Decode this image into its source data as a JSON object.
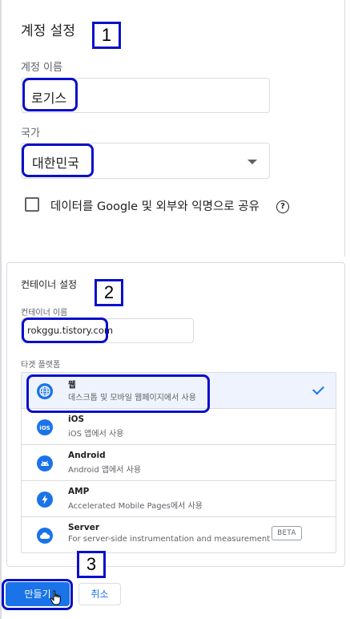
{
  "account": {
    "section_title": "계정 설정",
    "name_label": "계정 이름",
    "name_value": "로기스",
    "country_label": "국가",
    "country_value": "대한민국",
    "share_checkbox_label": "데이터를 Google 및 외부와 익명으로 공유",
    "share_checked": false
  },
  "container": {
    "section_title": "컨테이너 설정",
    "name_label": "컨테이너 이름",
    "name_value": "rokggu.tistory.com",
    "target_platform_label": "타겟 플랫폼",
    "platforms": [
      {
        "name": "웹",
        "description": "데스크톱 및 모바일 웹페이지에서 사용",
        "icon": "globe-icon",
        "selected": true
      },
      {
        "name": "iOS",
        "description": "iOS 앱에서 사용",
        "icon": "ios-icon",
        "selected": false
      },
      {
        "name": "Android",
        "description": "Android 앱에서 사용",
        "icon": "android-icon",
        "selected": false
      },
      {
        "name": "AMP",
        "description": "Accelerated Mobile Pages에서 사용",
        "icon": "amp-bolt-icon",
        "selected": false
      },
      {
        "name": "Server",
        "description": "For server-side instrumentation and measurement",
        "icon": "cloud-icon",
        "selected": false,
        "badge": "BETA"
      }
    ]
  },
  "actions": {
    "create_label": "만들기",
    "cancel_label": "취소"
  },
  "annotations": [
    "1",
    "2",
    "3"
  ],
  "colors": {
    "accent": "#1a73e8",
    "annotation_border": "#0a10c8",
    "selected_row_bg": "#eef3fd"
  }
}
